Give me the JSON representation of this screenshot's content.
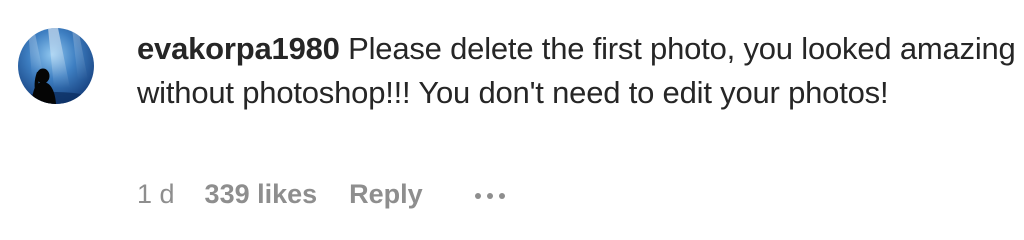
{
  "comment": {
    "username": "evakorpa1980",
    "text": "Please delete the first photo, you looked amazing without photoshop!!! You don't need to edit your photos!",
    "timestamp": "1 d",
    "likes": "339 likes",
    "reply_label": "Reply",
    "more_icon": "ellipsis-icon",
    "avatar_icon": "user-avatar-underwater"
  },
  "colors": {
    "text": "#262626",
    "meta": "#8e8e8e"
  }
}
